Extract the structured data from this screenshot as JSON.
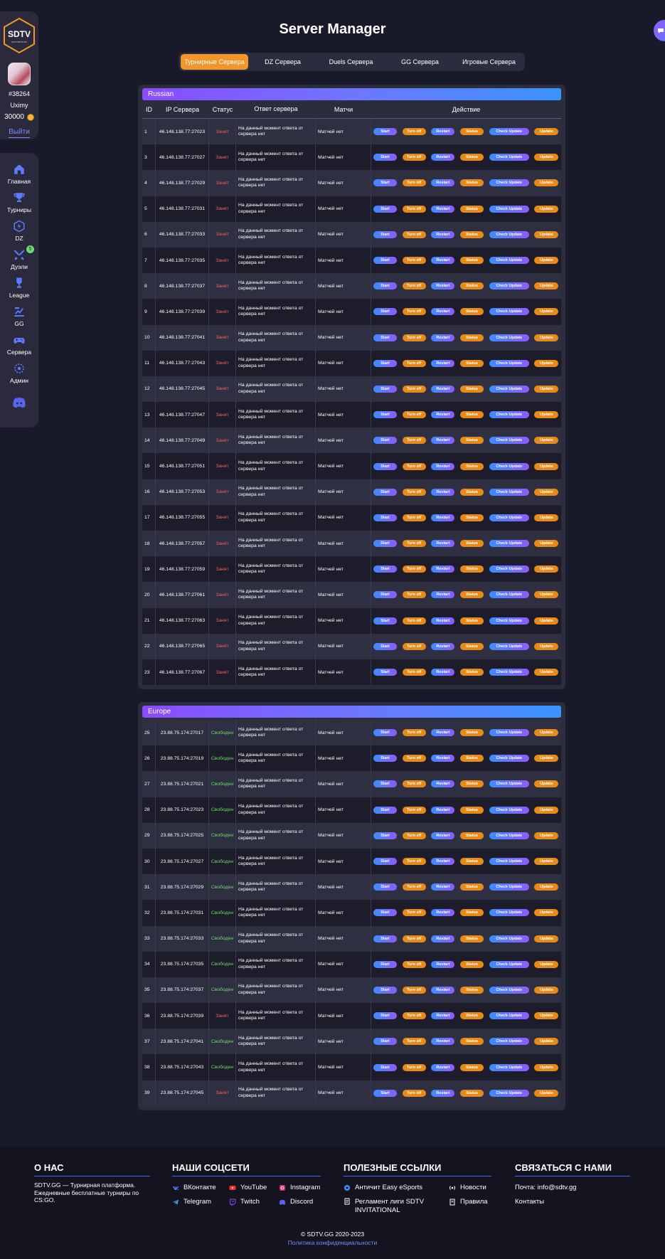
{
  "brand": {
    "logo_text": "SDTV",
    "logo_sub": "tournaments"
  },
  "user": {
    "id": "#38264",
    "name": "Uximy",
    "balance": "30000",
    "logout": "Выйти"
  },
  "nav": [
    {
      "label": "Главная",
      "icon": "home-icon"
    },
    {
      "label": "Турниры",
      "icon": "trophy-icon"
    },
    {
      "label": "DZ",
      "icon": "dz-shield-icon"
    },
    {
      "label": "Дуэли",
      "icon": "duel-swords-icon",
      "badge": "5"
    },
    {
      "label": "League",
      "icon": "league-cup-icon"
    },
    {
      "label": "GG",
      "icon": "gg-icon"
    },
    {
      "label": "Сервера",
      "icon": "gamepad-icon"
    },
    {
      "label": "Админ",
      "icon": "admin-icon"
    }
  ],
  "page": {
    "title": "Server Manager"
  },
  "tabs": [
    {
      "label": "Турнирные Сервера",
      "active": true
    },
    {
      "label": "DZ Сервера",
      "active": false
    },
    {
      "label": "Duels Сервера",
      "active": false
    },
    {
      "label": "GG Сервера",
      "active": false
    },
    {
      "label": "Игровые Сервера",
      "active": false
    }
  ],
  "table_headers": {
    "id": "ID",
    "ip": "IP Сервера",
    "status": "Статус",
    "response": "Ответ сервера",
    "matches": "Матчи",
    "action": "Действие"
  },
  "buttons": {
    "start": "Start",
    "off": "Turn off",
    "restart": "Restart",
    "status": "Status",
    "check": "Check Update",
    "update": "Update"
  },
  "response_text": "На данный момент ответа от сервера нет",
  "matches_text": "Матчей нет",
  "status_labels": {
    "busy": "Занят",
    "free": "Свободен"
  },
  "colors": {
    "accent_orange": "#f0962b",
    "busy": "#ff5b5b",
    "free": "#6fdc6f",
    "link": "#7d8bff"
  },
  "regions": [
    {
      "name": "Russian",
      "rows": [
        {
          "id": "1",
          "ip": "46.148.138.77:27023",
          "status": "busy"
        },
        {
          "id": "3",
          "ip": "46.148.138.77:27027",
          "status": "busy"
        },
        {
          "id": "4",
          "ip": "46.148.138.77:27029",
          "status": "busy"
        },
        {
          "id": "5",
          "ip": "46.148.138.77:27031",
          "status": "busy"
        },
        {
          "id": "6",
          "ip": "46.148.138.77:27033",
          "status": "busy"
        },
        {
          "id": "7",
          "ip": "46.148.138.77:27035",
          "status": "busy"
        },
        {
          "id": "8",
          "ip": "46.148.138.77:27037",
          "status": "busy"
        },
        {
          "id": "9",
          "ip": "46.148.138.77:27039",
          "status": "busy"
        },
        {
          "id": "10",
          "ip": "46.148.138.77:27041",
          "status": "busy"
        },
        {
          "id": "11",
          "ip": "46.148.138.77:27043",
          "status": "busy"
        },
        {
          "id": "12",
          "ip": "46.148.138.77:27045",
          "status": "busy"
        },
        {
          "id": "13",
          "ip": "46.148.138.77:27047",
          "status": "busy"
        },
        {
          "id": "14",
          "ip": "46.148.138.77:27049",
          "status": "busy"
        },
        {
          "id": "15",
          "ip": "46.148.138.77:27051",
          "status": "busy"
        },
        {
          "id": "16",
          "ip": "46.148.138.77:27053",
          "status": "busy"
        },
        {
          "id": "17",
          "ip": "46.148.138.77:27055",
          "status": "busy"
        },
        {
          "id": "18",
          "ip": "46.148.138.77:27057",
          "status": "busy"
        },
        {
          "id": "19",
          "ip": "46.148.138.77:27059",
          "status": "busy"
        },
        {
          "id": "20",
          "ip": "46.148.138.77:27061",
          "status": "busy"
        },
        {
          "id": "21",
          "ip": "46.148.138.77:27063",
          "status": "busy"
        },
        {
          "id": "22",
          "ip": "46.148.138.77:27065",
          "status": "busy"
        },
        {
          "id": "23",
          "ip": "46.148.138.77:27067",
          "status": "busy"
        }
      ]
    },
    {
      "name": "Europe",
      "rows": [
        {
          "id": "25",
          "ip": "23.88.75.174:27017",
          "status": "free"
        },
        {
          "id": "26",
          "ip": "23.88.75.174:27019",
          "status": "free"
        },
        {
          "id": "27",
          "ip": "23.88.75.174:27021",
          "status": "free"
        },
        {
          "id": "28",
          "ip": "23.88.75.174:27023",
          "status": "free"
        },
        {
          "id": "29",
          "ip": "23.88.75.174:27025",
          "status": "free"
        },
        {
          "id": "30",
          "ip": "23.88.75.174:27027",
          "status": "free"
        },
        {
          "id": "31",
          "ip": "23.88.75.174:27029",
          "status": "free"
        },
        {
          "id": "32",
          "ip": "23.88.75.174:27031",
          "status": "free"
        },
        {
          "id": "33",
          "ip": "23.88.75.174:27033",
          "status": "free"
        },
        {
          "id": "34",
          "ip": "23.88.75.174:27035",
          "status": "free"
        },
        {
          "id": "35",
          "ip": "23.88.75.174:27037",
          "status": "free"
        },
        {
          "id": "36",
          "ip": "23.88.75.174:27039",
          "status": "busy"
        },
        {
          "id": "37",
          "ip": "23.88.75.174:27041",
          "status": "free"
        },
        {
          "id": "38",
          "ip": "23.88.75.174:27043",
          "status": "free"
        },
        {
          "id": "39",
          "ip": "23.88.75.174:27045",
          "status": "busy"
        }
      ]
    }
  ],
  "footer": {
    "about": {
      "title": "О НАС",
      "text": "SDTV.GG — Турнирная платформа. Ежедневные бесплатные турниры по CS:GO."
    },
    "social": {
      "title": "НАШИ СОЦСЕТИ",
      "links": [
        {
          "label": "ВКонтакте",
          "icon": "vk-icon"
        },
        {
          "label": "YouTube",
          "icon": "youtube-icon"
        },
        {
          "label": "Instagram",
          "icon": "instagram-icon"
        },
        {
          "label": "Telegram",
          "icon": "telegram-icon"
        },
        {
          "label": "Twitch",
          "icon": "twitch-icon"
        },
        {
          "label": "Discord",
          "icon": "discord-icon"
        }
      ]
    },
    "useful": {
      "title": "ПОЛЕЗНЫЕ ССЫЛКИ",
      "links": [
        {
          "label": "Античит Easy eSports",
          "icon": "anticheat-icon"
        },
        {
          "label": "Новости",
          "icon": "news-icon"
        },
        {
          "label": "Регламент лиги SDTV INVITATIONAL",
          "icon": "rules-doc-icon"
        },
        {
          "label": "Правила",
          "icon": "rules-icon"
        }
      ]
    },
    "contact": {
      "title": "СВЯЗАТЬСЯ С НАМИ",
      "email": "Почта: info@sdtv.gg",
      "contacts": "Контакты"
    },
    "copyright": "© SDTV.GG 2020-2023",
    "policy": "Политика конфиденциальности"
  }
}
